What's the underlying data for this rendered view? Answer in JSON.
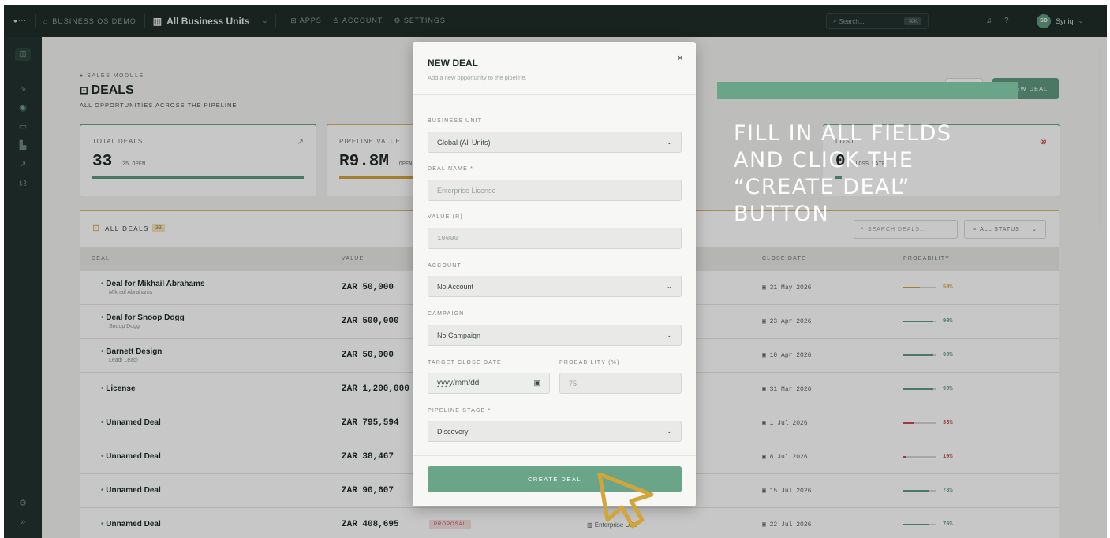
{
  "topbar": {
    "workspace": "BUSINESS OS DEMO",
    "unit_selector": "All Business Units",
    "nav": [
      "APPS",
      "ACCOUNT",
      "SETTINGS"
    ],
    "search_placeholder": "Search...",
    "search_shortcut": "⌘K",
    "user_initials": "SD",
    "user_name": "Syniq"
  },
  "page": {
    "module_label": "SALES MODULE",
    "title": "DEALS",
    "subtitle": "ALL OPPORTUNITIES ACROSS THE PIPELINE",
    "new_deal_button": "NEW DEAL"
  },
  "stats": [
    {
      "label": "TOTAL DEALS",
      "value": "33",
      "sub": "25 OPEN"
    },
    {
      "label": "PIPELINE VALUE",
      "value": "R9.8M",
      "sub": "OPEN"
    },
    {
      "label": "LOST",
      "value": "0",
      "sub": "LOSS RATE"
    }
  ],
  "table": {
    "title": "ALL DEALS",
    "count": "33",
    "search_placeholder": "SEARCH DEALS...",
    "status_filter": "ALL STATUS",
    "columns": [
      "DEAL",
      "VALUE",
      "CLOSE DATE",
      "PROBABILITY"
    ],
    "rows": [
      {
        "name": "Deal for Mikhail Abrahams",
        "sub": "Mikhail Abrahams",
        "value": "ZAR 50,000",
        "close": "31 May 2026",
        "prob": "50%",
        "prob_value": 50,
        "color": "#d1a53a"
      },
      {
        "name": "Deal for Snoop Dogg",
        "sub": "Snoop Dogg",
        "value": "ZAR 500,000",
        "close": "23 Apr 2026",
        "prob": "90%",
        "prob_value": 90,
        "color": "#5f9a80"
      },
      {
        "name": "Barnett Design",
        "sub": "Lead! Lead!",
        "value": "ZAR 50,000",
        "close": "10 Apr 2026",
        "prob": "90%",
        "prob_value": 90,
        "color": "#5f9a80"
      },
      {
        "name": "License",
        "sub": "",
        "value": "ZAR 1,200,000",
        "close": "31 Mar 2026",
        "prob": "90%",
        "prob_value": 90,
        "color": "#5f9a80"
      },
      {
        "name": "Unnamed Deal",
        "sub": "",
        "value": "ZAR 795,594",
        "close": "1 Jul 2026",
        "prob": "33%",
        "prob_value": 33,
        "color": "#c0504d"
      },
      {
        "name": "Unnamed Deal",
        "sub": "",
        "value": "ZAR 38,467",
        "close": "8 Jul 2026",
        "prob": "10%",
        "prob_value": 10,
        "color": "#c0504d"
      },
      {
        "name": "Unnamed Deal",
        "sub": "",
        "value": "ZAR 90,607",
        "close": "15 Jul 2026",
        "prob": "78%",
        "prob_value": 78,
        "color": "#5f9a80"
      },
      {
        "name": "Unnamed Deal",
        "sub": "",
        "value": "ZAR 408,695",
        "close": "22 Jul 2026",
        "prob": "76%",
        "prob_value": 76,
        "color": "#5f9a80",
        "stage": "PROPOSAL",
        "account": "Enterprise Unit"
      }
    ]
  },
  "modal": {
    "title": "NEW DEAL",
    "subtitle": "Add a new opportunity to the pipeline.",
    "close": "×",
    "business_unit_label": "BUSINESS UNIT",
    "business_unit_value": "Global (All Units)",
    "deal_name_label": "DEAL NAME *",
    "deal_name_placeholder": "Enterprise License",
    "value_label": "VALUE (R)",
    "value_placeholder": "10000",
    "account_label": "ACCOUNT",
    "account_value": "No Account",
    "campaign_label": "CAMPAIGN",
    "campaign_value": "No Campaign",
    "close_date_label": "TARGET CLOSE DATE",
    "close_date_value": "yyyy/mm/dd",
    "probability_label": "PROBABILITY (%)",
    "probability_placeholder": "75",
    "stage_label": "PIPELINE STAGE *",
    "stage_value": "Discovery",
    "submit": "CREATE DEAL"
  },
  "instruction": "FILL IN ALL FIELDS\nAND CLICK THE\n“CREATE DEAL”\nBUTTON"
}
